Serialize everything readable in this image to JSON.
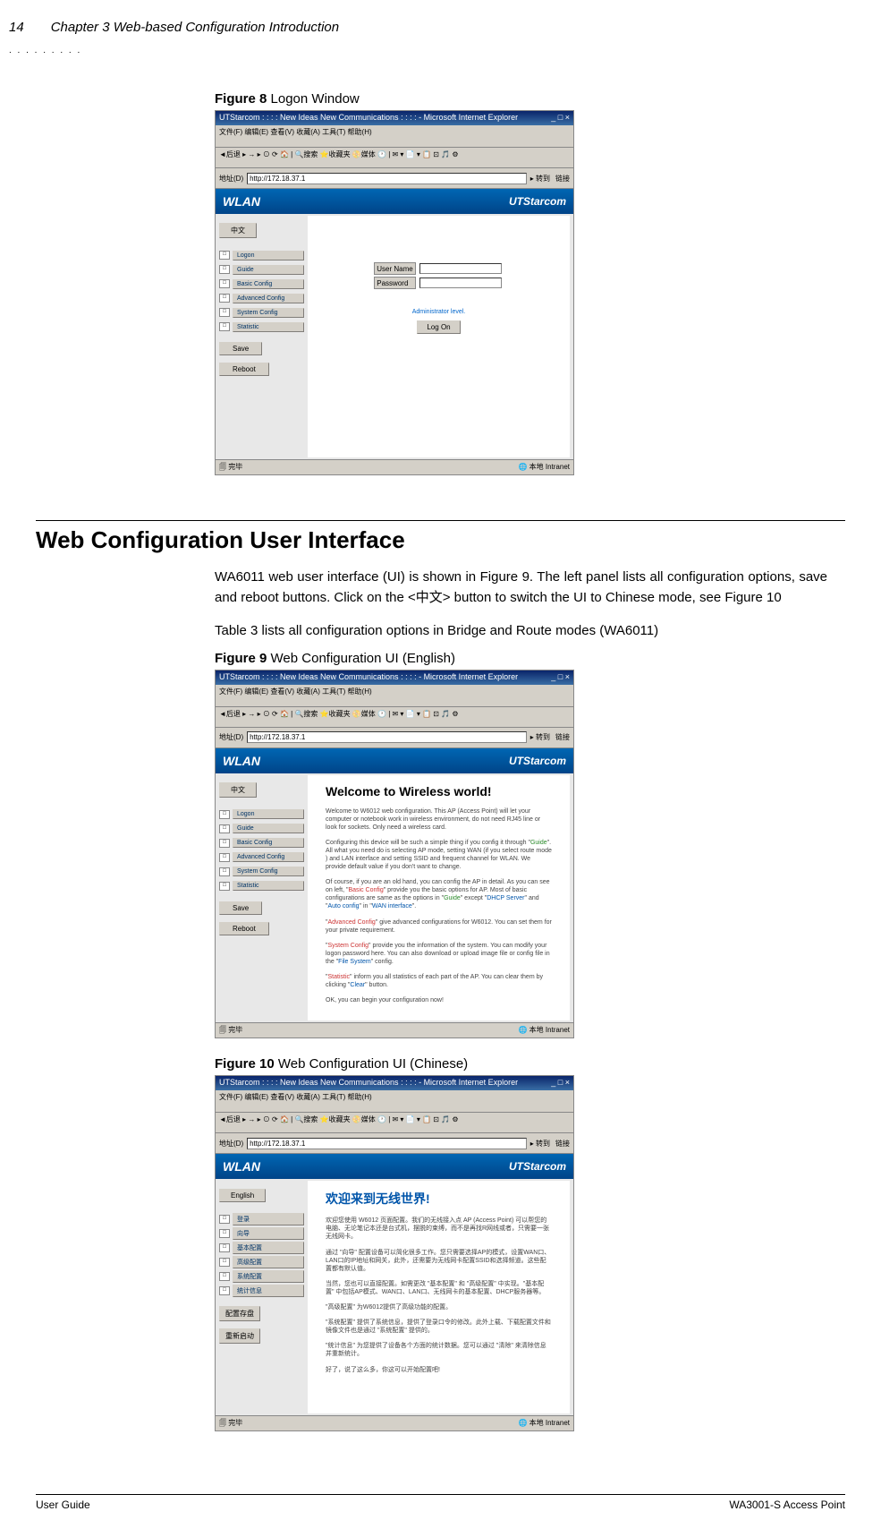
{
  "header": {
    "page_number": "14",
    "chapter": "Chapter 3 Web-based Configuration Introduction"
  },
  "figure8": {
    "caption_label": "Figure 8",
    "caption_text": " Logon Window",
    "ie_title": "UTStarcom : : : : New Ideas New Communications : : : :  - Microsoft Internet Explorer",
    "menu": "文件(F)  编辑(E)  查看(V)  收藏(A)  工具(T)  帮助(H)",
    "addr_label": "地址(D)",
    "addr_value": "http://172.18.37.1",
    "addr_go": "转到",
    "addr_links": "链接",
    "wlan": "WLAN",
    "brand": "UTStarcom",
    "lang_button": "中文",
    "nav": [
      "Logon",
      "Guide",
      "Basic Config",
      "Advanced Config",
      "System Config",
      "Statistic"
    ],
    "save": "Save",
    "reboot": "Reboot",
    "username_label": "User Name",
    "password_label": "Password",
    "admin_level": "Administrator level.",
    "logon_btn": "Log On",
    "status_left": "完毕",
    "status_right": "本地 Intranet"
  },
  "section": {
    "heading": "Web Configuration User Interface",
    "para1": "WA6011 web user interface (UI) is shown in Figure 9. The left panel lists all configuration options, save and reboot buttons. Click on the <中文> button to switch the UI to Chinese mode, see Figure 10",
    "para2": "Table 3 lists all configuration options in Bridge and Route modes (WA6011)"
  },
  "figure9": {
    "caption_label": "Figure 9",
    "caption_text": " Web Configuration UI (English)",
    "welcome_title": "Welcome to Wireless world!",
    "p1": "Welcome to W6012 web configuration. This AP (Access Point) will let your computer or notebook work in wireless environment, do not need RJ45 line or look for sockets. Only need a wireless card.",
    "p2a": "Configuring this device will be such a simple thing if you config it through \"",
    "p2b": "\". All what you need do is selecting AP mode, setting WAN (if you select route mode ) and LAN interface and setting SSID and frequent channel for WLAN. We provide default value if you don't want to change.",
    "guide": "Guide",
    "p3a": "Of course, if you are an old hand, you can config the AP in detail. As you can see on left, \"",
    "p3b": "\" provide you the basic options for AP. Most of basic configurations are same as the options in \"",
    "p3c": "\" except \"",
    "p3d": "\" and \"",
    "p3e": "\" in \"",
    "p3f": "\".",
    "basic_config": "Basic Config",
    "dhcp_server": "DHCP Server",
    "auto_config": "Auto config",
    "wan_interface": "WAN interface",
    "p4a": "\"",
    "p4b": "\" give advanced configurations for W6012. You can set them for your private requirement.",
    "advanced_config": "Advanced Config",
    "p5a": "\"",
    "p5b": "\" provide you the information of the system. You can modify your logon password here. You can also download or upload image file or config file in the \"",
    "p5c": "\" config.",
    "system_config": "System Config",
    "file_system": "File System",
    "p6a": "\"",
    "p6b": "\" inform you all statistics of each part of the AP. You can clear them by clicking \"",
    "p6c": "\" button.",
    "statistic": "Statistic",
    "clear": "Clear",
    "p7": "OK, you can begin your configuration now!"
  },
  "figure10": {
    "caption_label": "Figure 10",
    "caption_text": " Web Configuration UI (Chinese)",
    "lang_button": "English",
    "nav": [
      "登录",
      "向导",
      "基本配置",
      "高级配置",
      "系统配置",
      "统计信息"
    ],
    "save": "配置存盘",
    "reboot": "重新启动",
    "welcome_title": "欢迎来到无线世界!",
    "p1": "欢迎您使用 W6012 页面配置。我们的无线接入点 AP (Access Point) 可以帮您的电脑、无论笔记本还是台式机，摆脱的束缚，而不是再找R网线或者，只需要一张无线网卡。",
    "p2": "通过 \"向导\" 配置设备可以简化很多工作。您只需要选择AP的模式，设置WAN口、LAN口的IP地址和网关，此外，还需要为无线网卡配置SSID和选择频道。这些配置都有默认值。",
    "p3": "当然，您也可以直接配置。如需更改 \"基本配置\" 和 \"高级配置\" 中实现。\"基本配置\" 中包括AP模式、WAN口、LAN口、无线网卡的基本配置、DHCP服务器等。",
    "p4": "\"高级配置\" 为W6012提供了高级功能的配置。",
    "p5": "\"系统配置\" 提供了系统信息，提供了登录口令的修改。此外上载、下载配置文件和镜像文件也是通过 \"系统配置\" 提供的。",
    "p6": "\"统计信息\" 为您提供了设备各个方面的统计数据。您可以通过 \"清除\" 来清除信息并重新统计。",
    "p7": "好了，说了这么多，你这可以开始配置吧!"
  },
  "footer": {
    "left": "User Guide",
    "right": "WA3001-S Access Point"
  }
}
